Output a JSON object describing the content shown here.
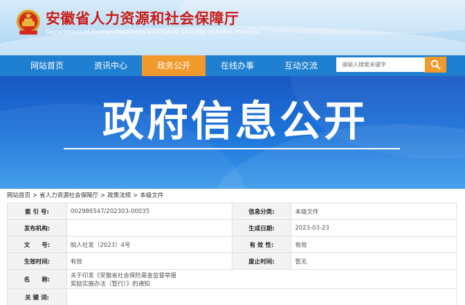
{
  "header": {
    "title": "安徽省人力资源和社会保障厅",
    "subtitle": "Department of Human Resources and Social Security of Anhui Province",
    "top_links": [
      "",
      "",
      ""
    ]
  },
  "nav": {
    "items": [
      {
        "label": "网站首页"
      },
      {
        "label": "资讯中心"
      },
      {
        "label": "政务公开"
      },
      {
        "label": "在线办事"
      },
      {
        "label": "互动交流"
      }
    ],
    "active_index": 2,
    "search_placeholder": "请输入搜索关键字"
  },
  "banner": {
    "title": "政府信息公开"
  },
  "breadcrumb": [
    "网站首页",
    "省人力资源社会保障厅",
    "政策法规",
    "本级文件"
  ],
  "info": {
    "rows": [
      {
        "l1": "索 引 号:",
        "v1": "002986547/202303-00035",
        "l2": "信息分类:",
        "v2": "本级文件"
      },
      {
        "l1": "发布机构:",
        "v1": "",
        "l2": "生成日期:",
        "v2": "2023-03-23"
      },
      {
        "l1": "文　　号:",
        "v1": "皖人社发〔2023〕4号",
        "l2": "有 效 性:",
        "v2": "有效"
      },
      {
        "l1": "生效时间:",
        "v1": "有效",
        "l2": "废止时间:",
        "v2": "暂无"
      }
    ],
    "name_label": "名　　称:",
    "name_line1": "关于印发《安徽省社会保险基金监督举报",
    "name_line2": "奖励实施办法（暂行）》的通知",
    "keywords_label": "关 键 词:"
  },
  "colors": {
    "title_red": "#c81d15",
    "nav_blue": "#1f7fd0",
    "nav_active_orange": "#f19a2c",
    "banner_blue": "#1a58c4"
  },
  "icons": {
    "emblem": "national-emblem-icon",
    "search": "search-icon"
  }
}
